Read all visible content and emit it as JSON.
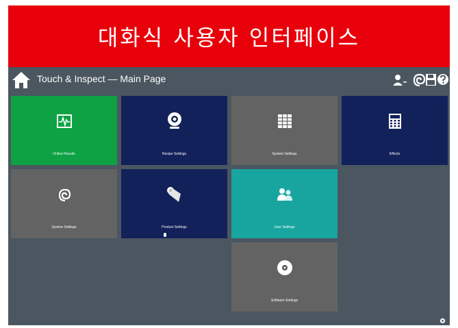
{
  "banner": {
    "text": "대화식 사용자 인터페이스"
  },
  "header": {
    "title": "Touch & Inspect — Main Page",
    "icons": [
      "home-icon",
      "user-icon",
      "spiral-logo-icon",
      "save-icon",
      "help-icon"
    ]
  },
  "tiles": [
    {
      "label": "Online Results",
      "icon": "chart-monitor-icon",
      "color": "#0ea245"
    },
    {
      "label": "Recipe Settings",
      "icon": "webcam-icon",
      "color": "#12215a"
    },
    {
      "label": "System Settings",
      "icon": "grid-table-icon",
      "color": "#636363"
    },
    {
      "label": "Effects",
      "icon": "calculator-icon",
      "color": "#12215a"
    },
    {
      "label": "System Settings",
      "icon": "spiral-logo-icon",
      "color": "#636363"
    },
    {
      "label": "Product Settings",
      "icon": "paper-roll-icon",
      "color": "#12215a"
    },
    {
      "label": "User Settings",
      "icon": "users-icon",
      "color": "#18a5a0"
    },
    {
      "label": "Software Settings",
      "icon": "disc-icon",
      "color": "#636363"
    }
  ],
  "colors": {
    "banner": "#e8000b",
    "background": "#4b5660",
    "green": "#0ea245",
    "navy": "#12215a",
    "gray": "#636363",
    "teal": "#18a5a0"
  }
}
